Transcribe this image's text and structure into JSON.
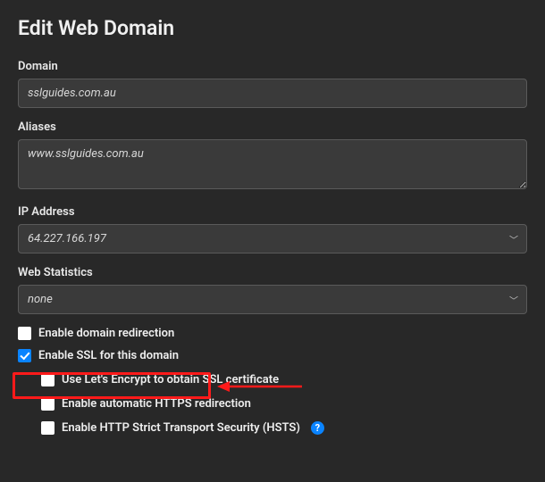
{
  "title": "Edit Web Domain",
  "fields": {
    "domain": {
      "label": "Domain",
      "value": "sslguides.com.au"
    },
    "aliases": {
      "label": "Aliases",
      "value": "www.sslguides.com.au"
    },
    "ip": {
      "label": "IP Address",
      "value": "64.227.166.197"
    },
    "webstats": {
      "label": "Web Statistics",
      "value": "none"
    }
  },
  "checkboxes": {
    "redirect": {
      "label": "Enable domain redirection",
      "checked": false
    },
    "ssl": {
      "label": "Enable SSL for this domain",
      "checked": true
    },
    "letsencrypt": {
      "label": "Use Let's Encrypt to obtain SSL certificate",
      "checked": false
    },
    "https_redirect": {
      "label": "Enable automatic HTTPS redirection",
      "checked": false
    },
    "hsts": {
      "label": "Enable HTTP Strict Transport Security (HSTS)",
      "checked": false
    }
  },
  "help_glyph": "?"
}
